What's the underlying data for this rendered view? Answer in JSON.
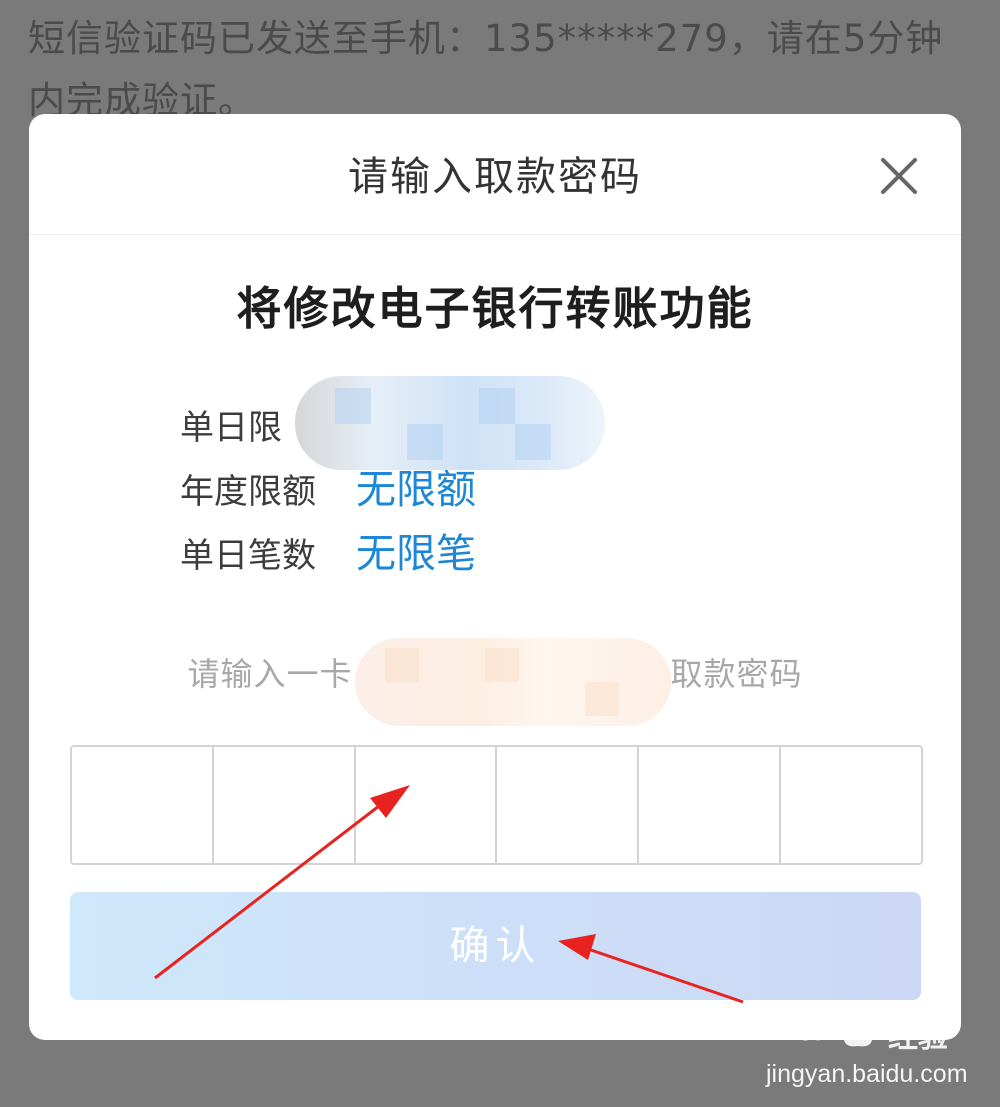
{
  "background": {
    "notice_text": "短信验证码已发送至手机：135*****279，请在5分钟内完成验证。"
  },
  "dialog": {
    "title": "请输入取款密码",
    "close_icon": "close-icon",
    "heading": "将修改电子银行转账功能",
    "limits": [
      {
        "label": "单日限",
        "value": ""
      },
      {
        "label": "年度限额",
        "value": "无限额"
      },
      {
        "label": "单日笔数",
        "value": "无限笔"
      }
    ],
    "password_hint": "请输入一卡通取款密码",
    "password_hint_start": "请输入一卡",
    "password_hint_end": "取款密码",
    "pin_cells": 6,
    "confirm_label": "确认"
  },
  "watermark": {
    "logo": "Bai du 经验",
    "logo_text": "Bai",
    "logo_text_2": "du",
    "brand_cn": "经验",
    "url": "jingyan.baidu.com"
  },
  "colors": {
    "overlay": "#7a7a7a",
    "link_blue": "#1d87d6",
    "confirm_disabled": "#cfe0f8",
    "annotation_red": "#e8231f"
  }
}
